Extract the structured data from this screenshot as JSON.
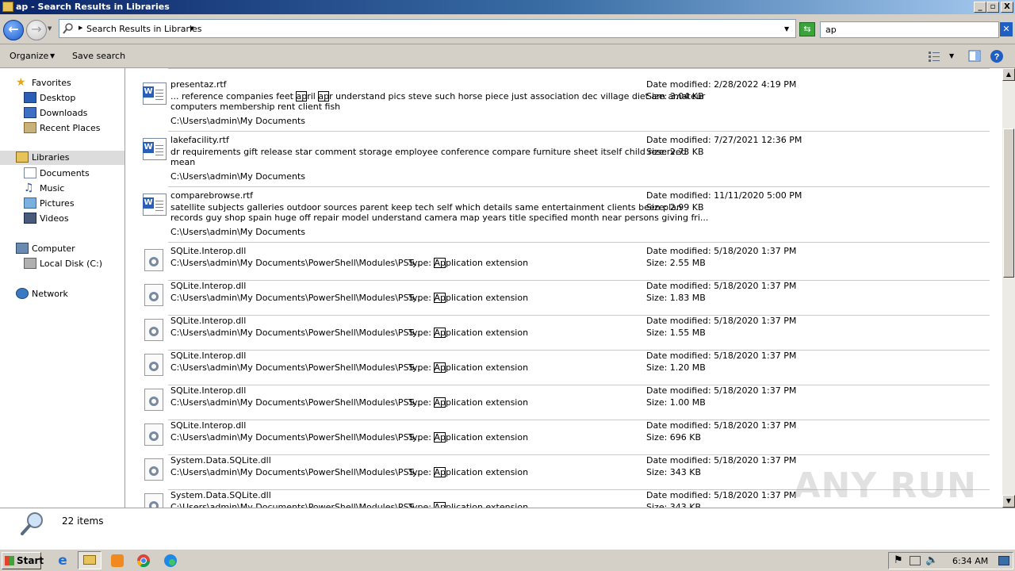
{
  "window": {
    "title": "ap - Search Results in Libraries",
    "minimize": "_",
    "maximize": "▫",
    "close": "X"
  },
  "address": {
    "breadcrumb": "Search Results in Libraries",
    "search_value": "ap"
  },
  "toolbar": {
    "organize": "Organize",
    "save_search": "Save search"
  },
  "nav": {
    "favorites": "Favorites",
    "desktop": "Desktop",
    "downloads": "Downloads",
    "recent_places": "Recent Places",
    "libraries": "Libraries",
    "documents": "Documents",
    "music": "Music",
    "pictures": "Pictures",
    "videos": "Videos",
    "computer": "Computer",
    "local_disk": "Local Disk (C:)",
    "network": "Network"
  },
  "results": {
    "doc1": {
      "name": "presentaz.rtf",
      "snippet_a": "... reference companies feet ",
      "snippet_hl1": "ap",
      "snippet_b": "ril ",
      "snippet_hl2": "ap",
      "snippet_c": "r understand pics steve such horse piece just association dec village diet am amateur",
      "snippet_line2": "computers membership rent client fish",
      "path": "C:\\Users\\admin\\My Documents",
      "date": "Date modified: 2/28/2022 4:19 PM",
      "size": "Size: 3.04 KB"
    },
    "doc2": {
      "name": "lakefacility.rtf",
      "snippet_line1": "dr requirements gift release star comment storage employee conference compare furniture sheet itself child reserved",
      "snippet_line2": "mean",
      "path": "C:\\Users\\admin\\My Documents",
      "date": "Date modified: 7/27/2021 12:36 PM",
      "size": "Size: 2.73 KB"
    },
    "doc3": {
      "name": "comparebrowse.rtf",
      "snippet_line1": "satellite subjects galleries outdoor sources parent keep tech self which details same entertainment clients been plan",
      "snippet_line2": "records guy shop spain huge off repair model understand camera map years title specified month near persons giving fri...",
      "path": "C:\\Users\\admin\\My Documents",
      "date": "Date modified: 11/11/2020 5:00 PM",
      "size": "Size: 2.99 KB"
    },
    "dll_path": "C:\\Users\\admin\\My Documents\\PowerShell\\Modules\\PSS...",
    "type_prefix": "Type: ",
    "type_hl": "Ap",
    "type_rest": "plication extension",
    "dll_date": "Date modified: 5/18/2020 1:37 PM",
    "dll_rows": [
      {
        "name": "SQLite.Interop.dll",
        "size": "Size: 2.55 MB"
      },
      {
        "name": "SQLite.Interop.dll",
        "size": "Size: 1.83 MB"
      },
      {
        "name": "SQLite.Interop.dll",
        "size": "Size: 1.55 MB"
      },
      {
        "name": "SQLite.Interop.dll",
        "size": "Size: 1.20 MB"
      },
      {
        "name": "SQLite.Interop.dll",
        "size": "Size: 1.00 MB"
      },
      {
        "name": "SQLite.Interop.dll",
        "size": "Size: 696 KB"
      },
      {
        "name": "System.Data.SQLite.dll",
        "size": "Size: 343 KB"
      },
      {
        "name": "System.Data.SQLite.dll",
        "size": "Size: 343 KB"
      }
    ]
  },
  "details": {
    "count": "22 items"
  },
  "taskbar": {
    "start": "Start",
    "clock": "6:34 AM"
  },
  "watermark": "ANY RUN"
}
